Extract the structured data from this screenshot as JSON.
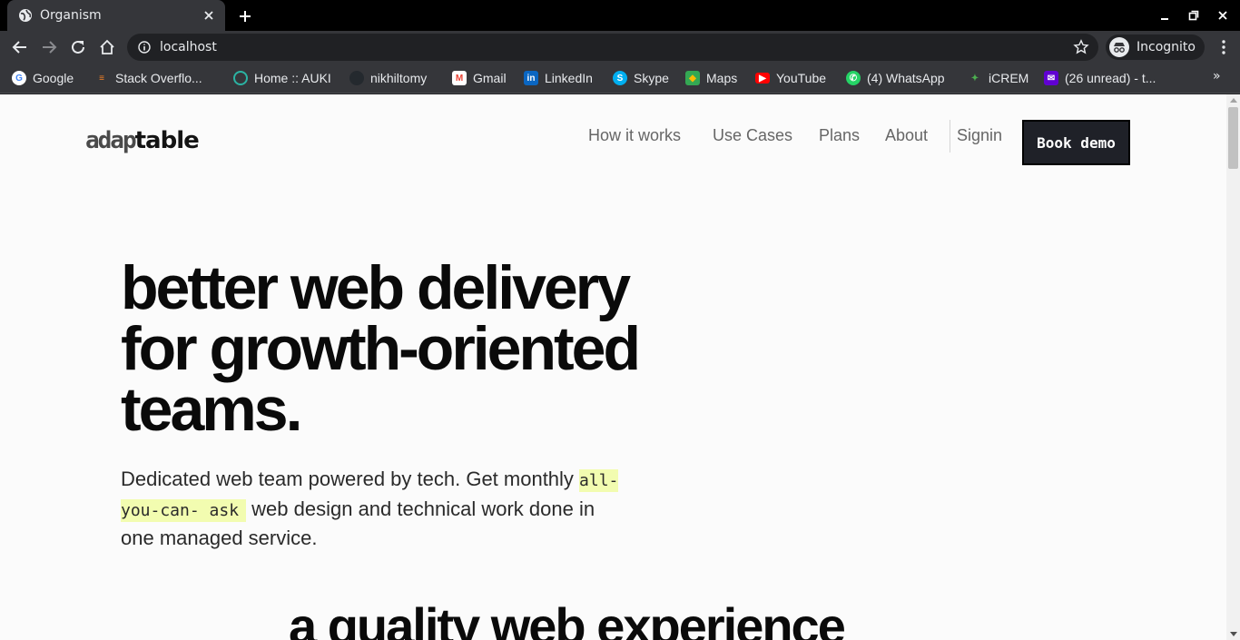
{
  "browser": {
    "tab": {
      "title": "Organism"
    },
    "address": {
      "url": "localhost"
    },
    "profile": {
      "label": "Incognito"
    },
    "bookmarks": [
      {
        "label": "Google",
        "icon": "google-icon",
        "color": "#ffffff"
      },
      {
        "label": "Stack Overflo...",
        "icon": "stackoverflow-icon",
        "color": "#f48024"
      },
      {
        "label": "Home :: AUKI",
        "icon": "auki-icon",
        "color": "#2bb3a3"
      },
      {
        "label": "nikhiltomy",
        "icon": "github-icon",
        "color": "#24292e"
      },
      {
        "label": "Gmail",
        "icon": "gmail-icon",
        "color": "#ea4335"
      },
      {
        "label": "LinkedIn",
        "icon": "linkedin-icon",
        "color": "#0a66c2"
      },
      {
        "label": "Skype",
        "icon": "skype-icon",
        "color": "#00aff0"
      },
      {
        "label": "Maps",
        "icon": "maps-icon",
        "color": "#34a853"
      },
      {
        "label": "YouTube",
        "icon": "youtube-icon",
        "color": "#ff0000"
      },
      {
        "label": "(4) WhatsApp",
        "icon": "whatsapp-icon",
        "color": "#25d366"
      },
      {
        "label": "iCREM",
        "icon": "icrem-icon",
        "color": "#4caf50"
      },
      {
        "label": "(26 unread) - t...",
        "icon": "yahoo-mail-icon",
        "color": "#6001d2"
      }
    ],
    "more_label": "»"
  },
  "site": {
    "logo": {
      "prefix": "adap",
      "suffix": "table"
    },
    "nav": {
      "how": "How it works",
      "use_cases": "Use Cases",
      "plans": "Plans",
      "about": "About",
      "signin": "Signin",
      "cta": "Book demo"
    },
    "hero": {
      "line1": "better web delivery",
      "line2": "for growth-oriented",
      "line3": "teams.",
      "sub_before": "Dedicated web team powered by tech. Get monthly ",
      "sub_highlight": "all-you-can- ask",
      "sub_after": " web design and technical work done in one managed service."
    },
    "section_title": "a quality web experience"
  }
}
